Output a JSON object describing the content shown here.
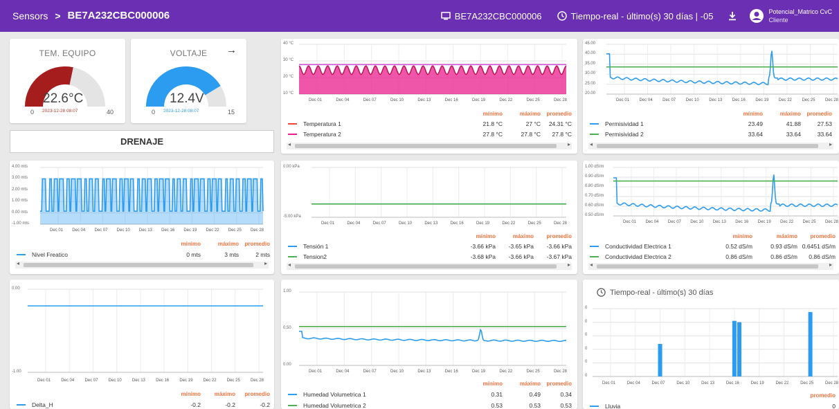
{
  "header": {
    "breadcrumb_root": "Sensors",
    "breadcrumb_sep": ">",
    "device_id": "BE7A232CBC000006",
    "device_chip": "BE7A232CBC000006",
    "time_range": "Tiempo-real - último(s) 30 días | -05",
    "user_name": "Potencial_Matrico CvC",
    "user_role": "Cliente"
  },
  "gauges": [
    {
      "title": "TEM. EQUIPO",
      "value": "22.6°C",
      "min": "0",
      "max": "40",
      "date": "2023-12-28 08:07",
      "fraction": 0.565,
      "color": "#a51d1d",
      "date_color": "#c0392b"
    },
    {
      "title": "VOLTAJE",
      "value": "12.4V",
      "min": "0",
      "max": "15",
      "date": "2023-12-28 08:07",
      "fraction": 0.827,
      "color": "#2c9cf0",
      "date_color": "#2c9cf0"
    }
  ],
  "drenaje_label": "DRENAJE",
  "stat_headers": {
    "min": "mínimo",
    "max": "máximo",
    "avg": "promedio"
  },
  "x_ticks": [
    "Dec 01",
    "Dec 04",
    "Dec 07",
    "Dec 10",
    "Dec 13",
    "Dec 16",
    "Dec 19",
    "Dec 22",
    "Dec 25",
    "Dec 28"
  ],
  "colors": {
    "blue": "#2c9cf0",
    "green": "#4caf50",
    "pink": "#e91e8c",
    "red": "#f44336",
    "header": "#6a2fb3",
    "accent": "#f4733e"
  },
  "chart_data": [
    {
      "type": "area",
      "id": "temperatura",
      "y_ticks": [
        "40 °C",
        "30 °C",
        "20 °C",
        "10 °C"
      ],
      "ylim": [
        10,
        40
      ],
      "series": [
        {
          "name": "Temperatura 1",
          "color": "#f44336",
          "min": "21.8 °C",
          "max": "27 °C",
          "avg": "24.31 °C",
          "pattern": "oscillating",
          "range": [
            21.8,
            27
          ]
        },
        {
          "name": "Temperatura 2",
          "color": "#e91e8c",
          "min": "27.8 °C",
          "max": "27.8 °C",
          "avg": "27.8 °C",
          "constant": 27.8
        }
      ]
    },
    {
      "type": "line",
      "id": "permisividad",
      "y_ticks": [
        "45.00",
        "40.00",
        "35.00",
        "30.00",
        "25.00",
        "20.00"
      ],
      "ylim": [
        20,
        45
      ],
      "series": [
        {
          "name": "Permisividad 1",
          "color": "#2c9cf0",
          "min": "23.49",
          "max": "41.88",
          "avg": "27.53",
          "pattern": "decay-spike",
          "range": [
            23.49,
            41.88
          ]
        },
        {
          "name": "Permisividad 2",
          "color": "#4caf50",
          "min": "33.64",
          "max": "33.64",
          "avg": "33.64",
          "constant": 33.64
        }
      ]
    },
    {
      "type": "area",
      "id": "nivel",
      "y_ticks": [
        "4.00 mts",
        "3.00 mts",
        "2.00 mts",
        "1.00 mts",
        "0.00 mts",
        "-1.00 mts"
      ],
      "ylim": [
        -1,
        4
      ],
      "series": [
        {
          "name": "Nivel Freatico",
          "color": "#2c9cf0",
          "min": "0 mts",
          "max": "3 mts",
          "avg": "2 mts",
          "pattern": "square",
          "range": [
            0,
            3
          ]
        }
      ]
    },
    {
      "type": "line",
      "id": "tension",
      "y_ticks": [
        "0.00 kPa",
        "-5.00 kPa"
      ],
      "ylim": [
        -5,
        0
      ],
      "series": [
        {
          "name": "Tensión 1",
          "color": "#2c9cf0",
          "min": "-3.66 kPa",
          "max": "-3.65 kPa",
          "avg": "-3.66 kPa",
          "constant": -3.66
        },
        {
          "name": "Tension2",
          "color": "#4caf50",
          "min": "-3.68 kPa",
          "max": "-3.66 kPa",
          "avg": "-3.67 kPa",
          "constant": -3.67
        }
      ]
    },
    {
      "type": "line",
      "id": "conductividad",
      "y_ticks": [
        "1.00 dS/m",
        "0.90 dS/m",
        "0.80 dS/m",
        "0.70 dS/m",
        "0.60 dS/m",
        "0.50 dS/m"
      ],
      "ylim": [
        0.5,
        1.0
      ],
      "series": [
        {
          "name": "Conductividad Electrica 1",
          "color": "#2c9cf0",
          "min": "0.52 dS/m",
          "max": "0.93 dS/m",
          "avg": "0.6451 dS/m",
          "pattern": "decay-spike",
          "range": [
            0.52,
            0.93
          ]
        },
        {
          "name": "Conductividad Electrica 2",
          "color": "#4caf50",
          "min": "0.86 dS/m",
          "max": "0.86 dS/m",
          "avg": "0.86 dS/m",
          "constant": 0.86
        }
      ]
    },
    {
      "type": "line",
      "id": "delta",
      "y_ticks": [
        "0.00",
        "-1.00"
      ],
      "ylim": [
        -1,
        0
      ],
      "series": [
        {
          "name": "Delta_H",
          "color": "#2c9cf0",
          "min": "-0.2",
          "max": "-0.2",
          "avg": "-0.2",
          "constant": -0.2
        }
      ]
    },
    {
      "type": "line",
      "id": "humedad",
      "y_ticks": [
        "1.00",
        "0.50",
        "0.00"
      ],
      "ylim": [
        0,
        1
      ],
      "series": [
        {
          "name": "Humedad Volumetrica 1",
          "color": "#2c9cf0",
          "min": "0.31",
          "max": "0.49",
          "avg": "0.34",
          "pattern": "flat-spike",
          "range": [
            0.31,
            0.49
          ]
        },
        {
          "name": "Humedad Volumetrica 2",
          "color": "#4caf50",
          "min": "0.53",
          "max": "0.53",
          "avg": "0.53",
          "constant": 0.53
        }
      ]
    },
    {
      "type": "bar",
      "id": "lluvia",
      "title": "Tiempo-real - último(s) 30 días",
      "y_ticks": [
        "0",
        "0",
        "0",
        "0",
        "0",
        "0"
      ],
      "avg_header": "promedio",
      "bars": [
        {
          "x": 7.0,
          "h": 0.48
        },
        {
          "x": 16.0,
          "h": 0.82
        },
        {
          "x": 16.6,
          "h": 0.8
        },
        {
          "x": 25.2,
          "h": 0.95
        }
      ],
      "series": [
        {
          "name": "Lluvia",
          "color": "#2c9cf0",
          "avg": "0"
        }
      ]
    }
  ]
}
